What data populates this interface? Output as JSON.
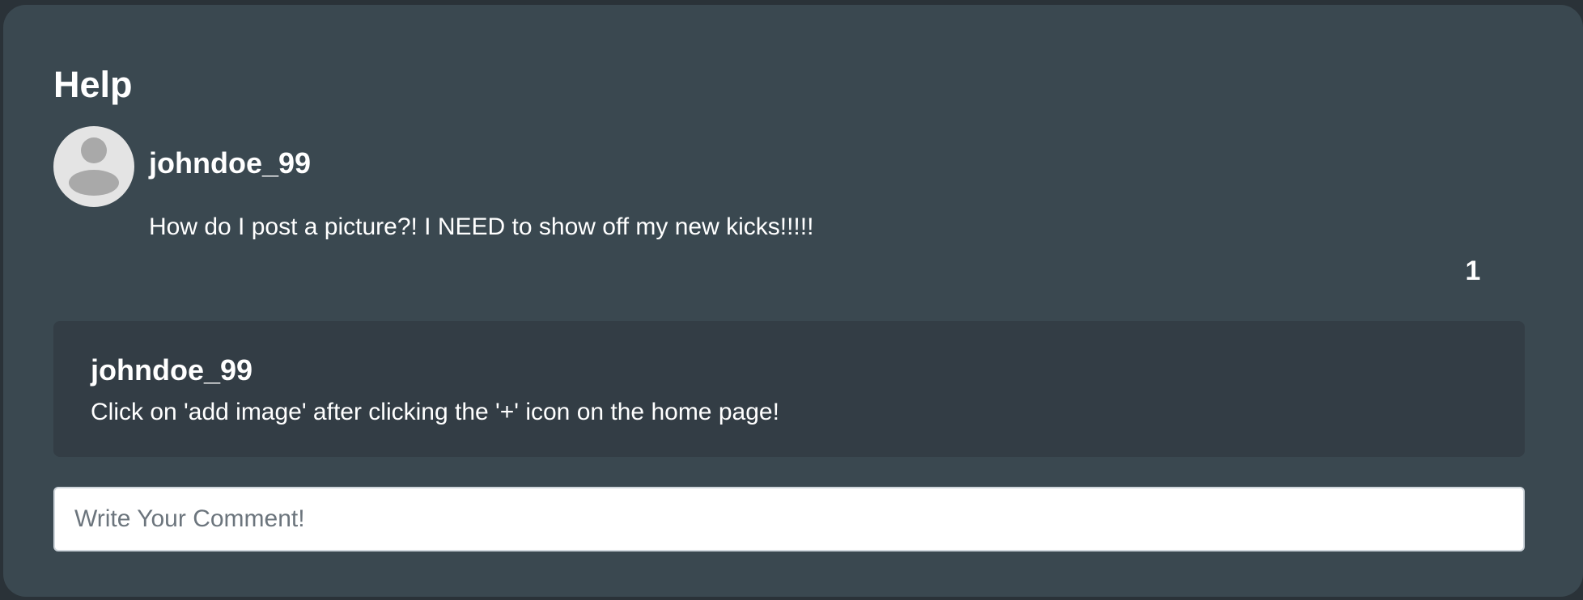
{
  "page": {
    "title": "Help"
  },
  "post": {
    "author": "johndoe_99",
    "avatar_icon": "user-silhouette-icon",
    "body": "How do I post a picture?! I NEED to show off my new kicks!!!!!",
    "comment_count": "1"
  },
  "comments": [
    {
      "author": "johndoe_99",
      "text": "Click on 'add image' after clicking the '+' icon on the home page!"
    }
  ],
  "comment_input": {
    "value": "",
    "placeholder": "Write Your Comment!"
  },
  "colors": {
    "page_background": "#2a3238",
    "card_background": "#3a4850",
    "comment_background": "#333d45",
    "text": "#ffffff",
    "avatar_background": "#e4e4e4",
    "avatar_figure": "#a9a9a9"
  }
}
